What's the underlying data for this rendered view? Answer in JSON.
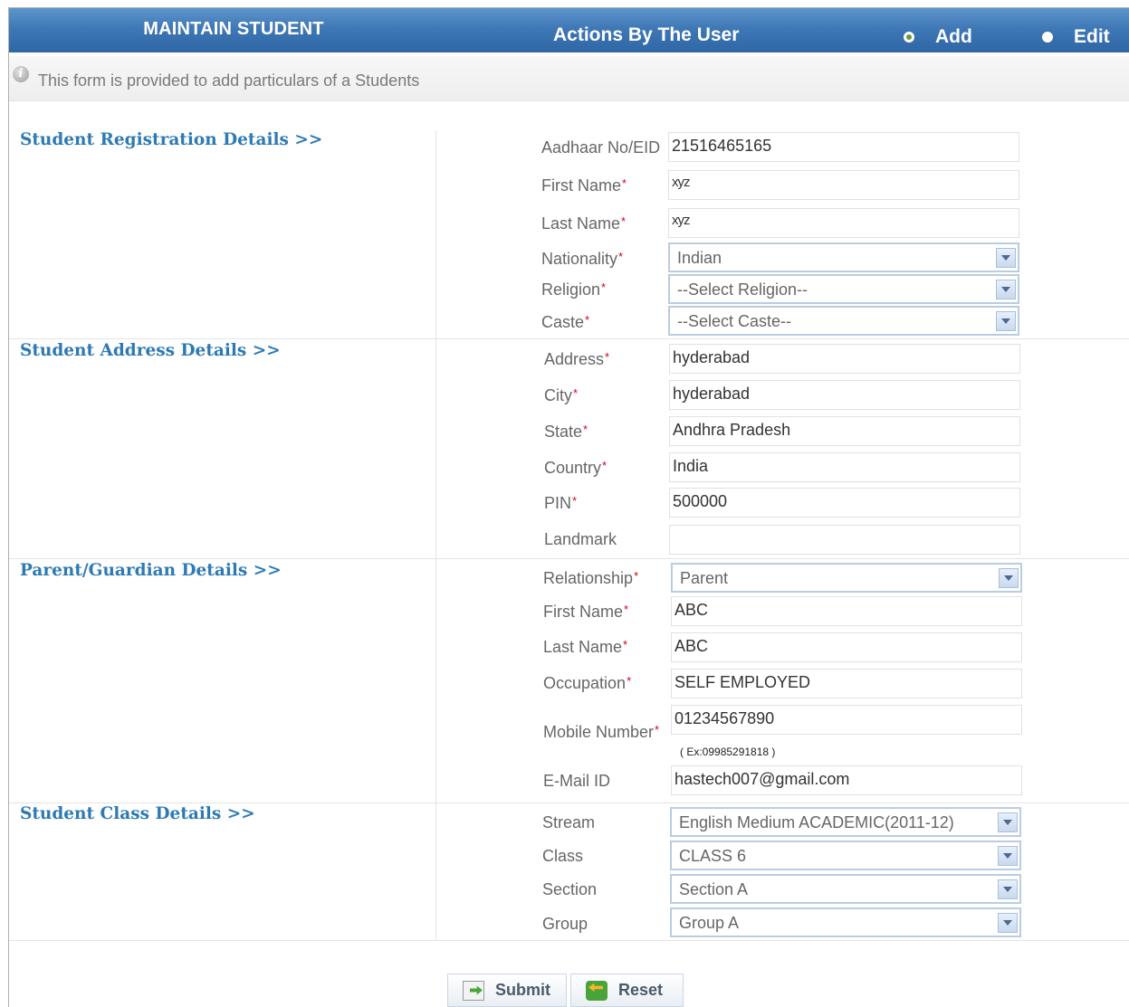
{
  "header": {
    "title": "MAINTAIN STUDENT",
    "actions_label": "Actions By The User",
    "modes": [
      {
        "label": "Add",
        "selected": true
      },
      {
        "label": "Edit",
        "selected": false
      }
    ]
  },
  "info": {
    "icon": "info-icon",
    "text": "This form is provided to add particulars of a Students"
  },
  "sections": {
    "registration": {
      "heading": "Student Registration Details >>",
      "aadhaar": {
        "label": "Aadhaar No/EID",
        "value": "21516465165"
      },
      "first_name": {
        "label": "First Name",
        "value": "xyz"
      },
      "last_name": {
        "label": "Last Name",
        "value": "xyz"
      },
      "nationality": {
        "label": "Nationality",
        "value": "Indian"
      },
      "religion": {
        "label": "Religion",
        "value": "--Select Religion--"
      },
      "caste": {
        "label": "Caste",
        "value": "--Select Caste--"
      }
    },
    "address": {
      "heading": "Student Address Details >>",
      "address": {
        "label": "Address",
        "value": "hyderabad"
      },
      "city": {
        "label": "City",
        "value": "hyderabad"
      },
      "state": {
        "label": "State",
        "value": "Andhra Pradesh"
      },
      "country": {
        "label": "Country",
        "value": "India"
      },
      "pin": {
        "label": "PIN",
        "value": "500000"
      },
      "landmark": {
        "label": "Landmark",
        "value": ""
      }
    },
    "parent": {
      "heading": "Parent/Guardian Details >>",
      "relationship": {
        "label": "Relationship",
        "value": "Parent"
      },
      "first_name": {
        "label": "First Name",
        "value": "ABC"
      },
      "last_name": {
        "label": "Last Name",
        "value": "ABC"
      },
      "occupation": {
        "label": "Occupation",
        "value": "SELF EMPLOYED"
      },
      "mobile": {
        "label": "Mobile Number",
        "value": "01234567890",
        "hint": "( Ex:09985291818 )"
      },
      "email": {
        "label": "E-Mail ID",
        "value": "hastech007@gmail.com"
      }
    },
    "class": {
      "heading": "Student Class Details >>",
      "stream": {
        "label": "Stream",
        "value": "English Medium ACADEMIC(2011-12)"
      },
      "class": {
        "label": "Class",
        "value": "CLASS 6"
      },
      "section": {
        "label": "Section",
        "value": "Section A"
      },
      "group": {
        "label": "Group",
        "value": "Group A"
      }
    }
  },
  "buttons": {
    "submit": "Submit",
    "reset": "Reset"
  },
  "required_marker": "*"
}
